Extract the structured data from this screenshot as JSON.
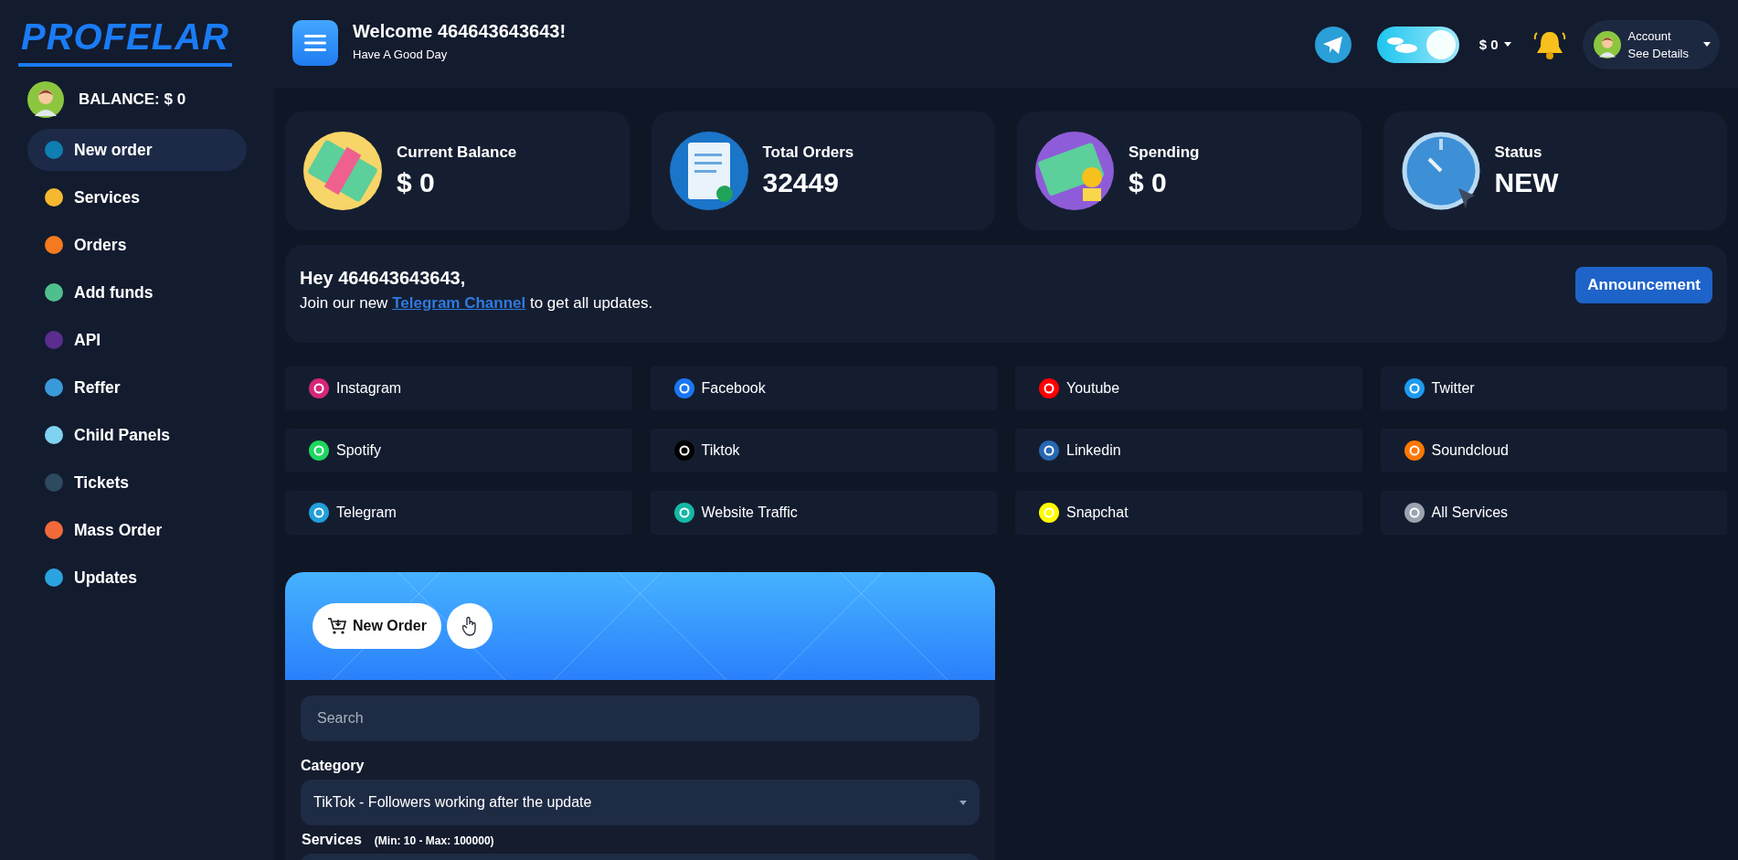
{
  "logo": "PROFELAR",
  "balance": "BALANCE: $ 0",
  "sidebar": {
    "items": [
      {
        "label": "New order",
        "selected": true,
        "color": "#0e7fb0"
      },
      {
        "label": "Services",
        "selected": false,
        "color": "#f5b82e"
      },
      {
        "label": "Orders",
        "selected": false,
        "color": "#f47a1f"
      },
      {
        "label": "Add funds",
        "selected": false,
        "color": "#4fc08d"
      },
      {
        "label": "API",
        "selected": false,
        "color": "#5b2d8e"
      },
      {
        "label": "Reffer",
        "selected": false,
        "color": "#3a9ad9"
      },
      {
        "label": "Child Panels",
        "selected": false,
        "color": "#7fd3f0"
      },
      {
        "label": "Tickets",
        "selected": false,
        "color": "#2d4a5e"
      },
      {
        "label": "Mass Order",
        "selected": false,
        "color": "#f06a3a"
      },
      {
        "label": "Updates",
        "selected": false,
        "color": "#2aa3e0"
      }
    ]
  },
  "header": {
    "welcome": "Welcome  464643643643!",
    "subtitle": "Have A Good Day",
    "theme_toggle": {
      "on": true
    },
    "currency": "$ 0",
    "account": {
      "title": "Account",
      "subtitle": "See Details"
    }
  },
  "stats": [
    {
      "kind": "money",
      "label": "Current Balance",
      "value": "$ 0"
    },
    {
      "kind": "document",
      "label": "Total Orders",
      "value": "32449"
    },
    {
      "kind": "spending",
      "label": "Spending",
      "value": "$ 0"
    },
    {
      "kind": "clock",
      "label": "Status",
      "value": "NEW"
    }
  ],
  "announcement": {
    "greeting": "Hey 464643643643,",
    "text_before": "Join our new",
    "link": "Telegram Channel",
    "text_after": "to get all updates.",
    "button": "Announcement"
  },
  "platforms": [
    {
      "label": "Instagram",
      "color": "#d6267a"
    },
    {
      "label": "Facebook",
      "color": "#1877f2"
    },
    {
      "label": "Youtube",
      "color": "#ff0000"
    },
    {
      "label": "Twitter",
      "color": "#1d9bf0"
    },
    {
      "label": "Spotify",
      "color": "#1ed760"
    },
    {
      "label": "Tiktok",
      "color": "#000000"
    },
    {
      "label": "Linkedin",
      "color": "#2867b2"
    },
    {
      "label": "Soundcloud",
      "color": "#ff7700"
    },
    {
      "label": "Telegram",
      "color": "#229ed9"
    },
    {
      "label": "Website Traffic",
      "color": "#14b8a6"
    },
    {
      "label": "Snapchat",
      "color": "#fffc00"
    },
    {
      "label": "All Services",
      "color": "#9ca3af"
    }
  ],
  "order_form": {
    "tab": "New Order",
    "search": {
      "placeholder": "Search"
    },
    "category": {
      "label": "Category",
      "value": "TikTok - Followers working after the update"
    },
    "services": {
      "label": "Services",
      "hint": "(Min: 10 - Max: 100000)"
    }
  }
}
